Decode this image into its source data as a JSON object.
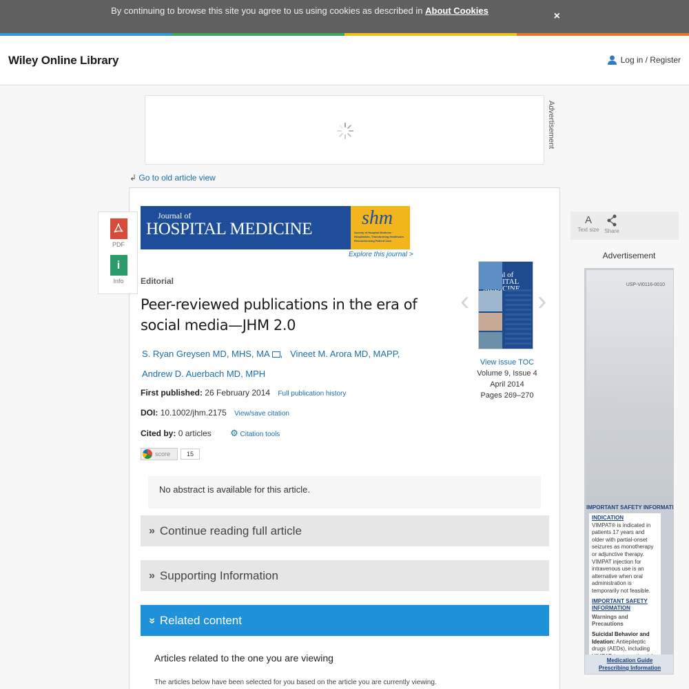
{
  "cookie_bar": {
    "text": "By continuing to browse this site you agree to us using cookies as described in",
    "link": "About Cookies",
    "close": "×"
  },
  "header": {
    "logo": "Wiley Online Library",
    "login": "Log in / Register"
  },
  "ads": {
    "top_label": "Advertisement",
    "rail_label": "Advertisement",
    "rail_code": "USP-VI0116-0010",
    "rail_isi_title": "IMPORTANT SAFETY INFORMATIO",
    "rail_indication": "INDICATION",
    "rail_indication_text": "VIMPAT® is indicated in patients 17 years and older with partial-onset seizures as monotherapy or adjunctive therapy. VIMPAT injection for intravenous use is an alternative when oral administration is temporarily not feasible.",
    "rail_safety": "IMPORTANT SAFETY INFORMATION",
    "rail_warnings": "Warnings and Precautions",
    "rail_suicidal": "Suicidal Behavior and Ideation:",
    "rail_suicidal_text": "Antiepileptic drugs (AEDs), including VIMPAT, increase the risk",
    "rail_med_guide": "Medication Guide",
    "rail_prescribing": "Prescribing Information"
  },
  "nav": {
    "old_view": "Go to old article view"
  },
  "tools": {
    "pdf": "PDF",
    "info": "Info"
  },
  "journal": {
    "title_line1": "Journal of",
    "title_line2": "HOSPITAL MEDICINE",
    "society": "shm",
    "society_sub": "Society of Hospital Medicine · Hospitalists. Transforming Healthcare. Revolutionizing Patient Care.",
    "explore": "Explore this journal >"
  },
  "article": {
    "section": "Editorial",
    "title": "Peer-reviewed publications in the era of social media—JHM 2.0",
    "authors": [
      "S. Ryan Greysen MD, MHS, MA",
      "Vineet M. Arora MD, MAPP,",
      "Andrew D. Auerbach MD, MPH"
    ],
    "first_published_label": "First published:",
    "first_published": "26 February 2014",
    "history_link": "Full publication history",
    "doi_label": "DOI:",
    "doi": "10.1002/jhm.2175",
    "doi_link": "View/save citation",
    "cited_by_label": "Cited by:",
    "cited_by": "0 articles",
    "citation_tools": "Citation tools",
    "altmetric_label": "score",
    "altmetric_score": "15",
    "abstract": "No abstract is available for this article."
  },
  "issue": {
    "toc": "View issue TOC",
    "volume": "Volume 9, Issue 4",
    "date": "April 2014",
    "pages": "Pages 269–270",
    "cover_title_1": "Journal of",
    "cover_title_2": "HOSPITAL MEDICINE"
  },
  "sections": {
    "continue": "Continue reading full article",
    "supporting": "Supporting Information",
    "related": "Related content"
  },
  "related": {
    "heading": "Articles related to the one you are viewing",
    "text": "The articles below have been selected for you based on the article you are currently viewing."
  },
  "rail": {
    "text_size": "Text size",
    "share": "Share"
  },
  "colors": {
    "stripe": [
      "#2f9ad8",
      "#3aaa5a",
      "#f3c21a",
      "#e8762a"
    ],
    "link": "#1a6ea8",
    "accordion_active": "#1f91d8",
    "pdf_red": "#d64b3a",
    "info_green": "#2a9a6a"
  }
}
